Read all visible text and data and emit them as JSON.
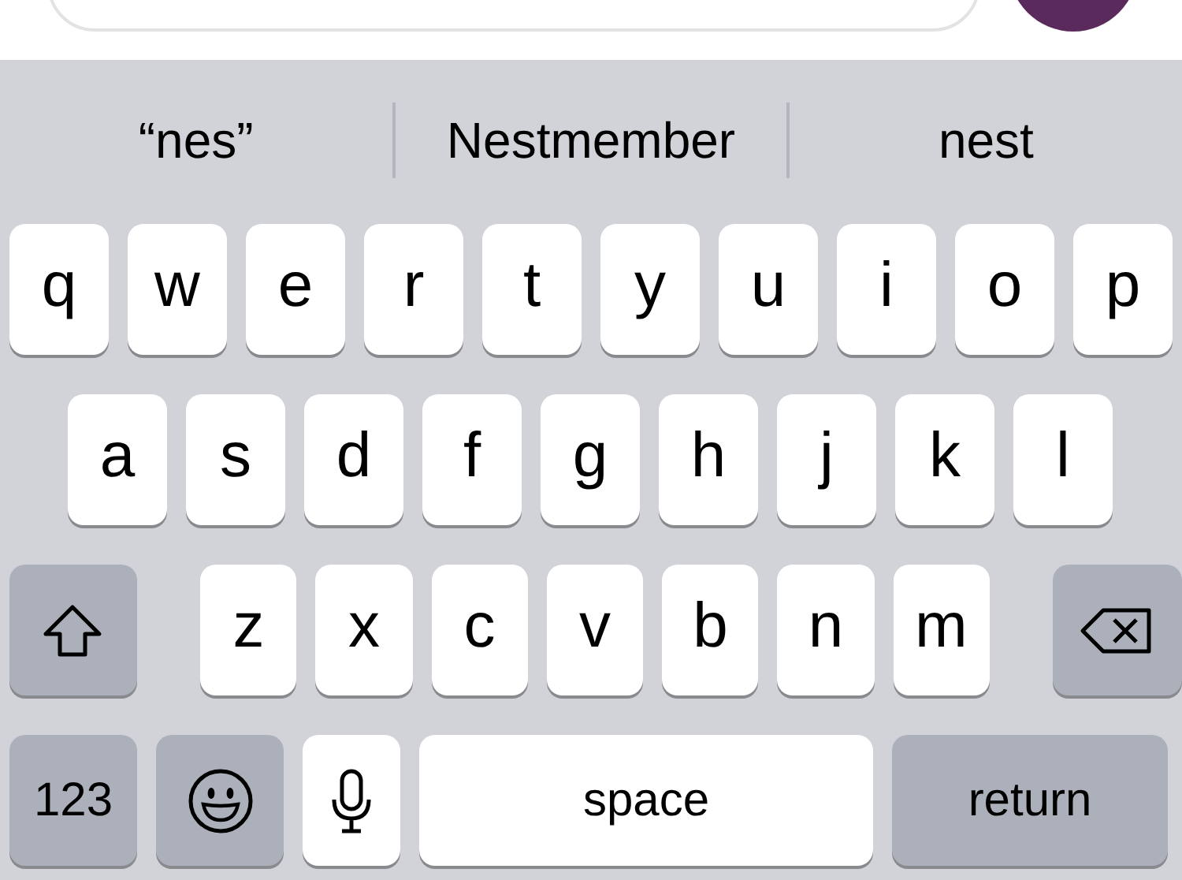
{
  "suggestions": [
    {
      "text": "“nes”"
    },
    {
      "text": "Nestmember"
    },
    {
      "text": "nest"
    }
  ],
  "rows": [
    [
      "q",
      "w",
      "e",
      "r",
      "t",
      "y",
      "u",
      "i",
      "o",
      "p"
    ],
    [
      "a",
      "s",
      "d",
      "f",
      "g",
      "h",
      "j",
      "k",
      "l"
    ],
    [
      "z",
      "x",
      "c",
      "v",
      "b",
      "n",
      "m"
    ]
  ],
  "bottom_row": {
    "numbers": "123",
    "space": "space",
    "return": "return"
  }
}
